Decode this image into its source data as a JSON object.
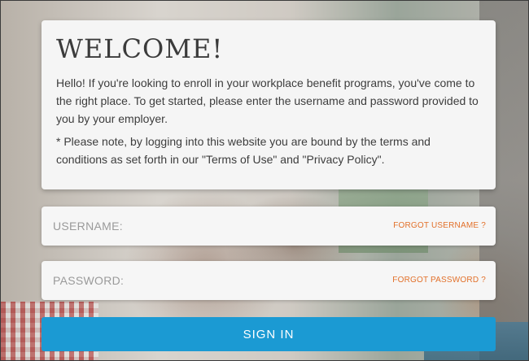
{
  "welcome": {
    "title": "WELCOME!",
    "paragraph1": "Hello! If you're looking to enroll in your workplace benefit programs, you've come to the right place. To get started, please enter the username and password provided to you by your employer.",
    "paragraph2": "* Please note, by logging into this website you are bound by the terms and conditions as set forth in our \"Terms of Use\" and \"Privacy Policy\"."
  },
  "login": {
    "username": {
      "placeholder": "USERNAME:",
      "value": "",
      "forgot_label": "FORGOT USERNAME ?"
    },
    "password": {
      "placeholder": "PASSWORD:",
      "value": "",
      "forgot_label": "FORGOT PASSWORD ?"
    },
    "sign_in_label": "SIGN IN"
  },
  "colors": {
    "accent_button": "#1b9ad3",
    "link": "#e2702a",
    "card_background": "#f5f5f5"
  }
}
